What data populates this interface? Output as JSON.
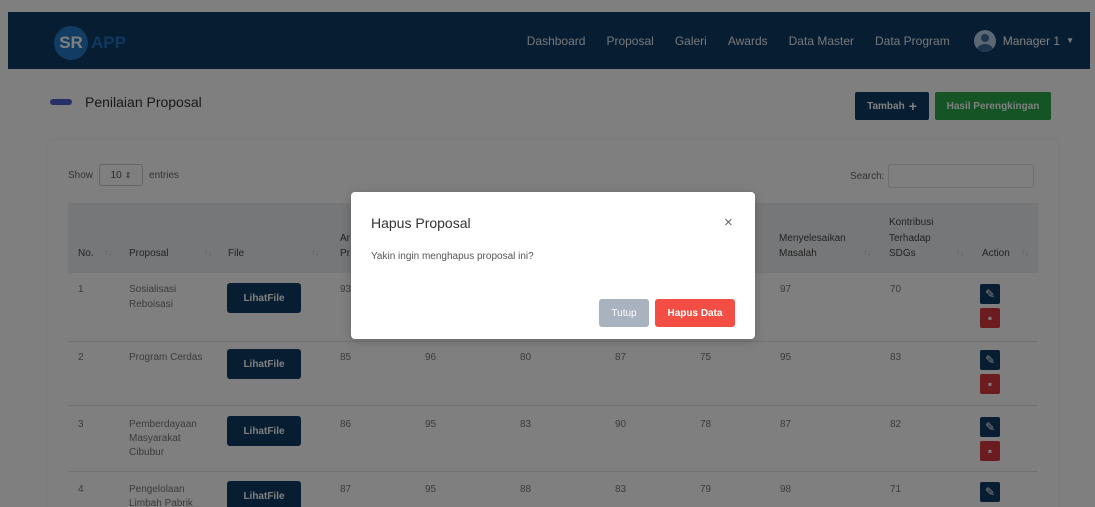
{
  "brand": {
    "logo_short": "SR",
    "logo_app": "APP"
  },
  "nav": {
    "items": [
      {
        "label": "Dashboard"
      },
      {
        "label": "Proposal"
      },
      {
        "label": "Galeri"
      },
      {
        "label": "Awards"
      },
      {
        "label": "Data Master"
      },
      {
        "label": "Data Program"
      }
    ],
    "user": "Manager 1"
  },
  "page": {
    "title": "Penilaian Proposal",
    "btn_tambah": "Tambah",
    "btn_hasil": "Hasil Perengkingan"
  },
  "table_controls": {
    "show_label": "Show",
    "show_value": "10",
    "entries_label": "entries",
    "search_label": "Search:"
  },
  "table": {
    "headers": {
      "no": "No.",
      "proposal": "Proposal",
      "file": "File",
      "ar": "Ar",
      "pr": "Pr",
      "menyelesaikan_1": "Menyelesaikan",
      "menyelesaikan_2": "Masalah",
      "kontribusi_1": "Kontribusi",
      "kontribusi_2": "Terhadap",
      "kontribusi_3": "SDGs",
      "action": "Action"
    },
    "file_label": "LihatFile",
    "rows": [
      {
        "no": "1",
        "proposal_1": "Sosialisasi",
        "proposal_2": "Reboisasi",
        "proposal_3": "",
        "c1": "93",
        "c2": "",
        "c3": "",
        "c4": "",
        "c5": "",
        "c6": "97",
        "c7": "70"
      },
      {
        "no": "2",
        "proposal_1": "Program Cerdas",
        "proposal_2": "",
        "proposal_3": "",
        "c1": "85",
        "c2": "96",
        "c3": "80",
        "c4": "87",
        "c5": "75",
        "c6": "95",
        "c7": "83"
      },
      {
        "no": "3",
        "proposal_1": "Pemberdayaan",
        "proposal_2": "Masyarakat",
        "proposal_3": "Cibubur",
        "c1": "86",
        "c2": "95",
        "c3": "83",
        "c4": "90",
        "c5": "78",
        "c6": "87",
        "c7": "82"
      },
      {
        "no": "4",
        "proposal_1": "Pengelolaan",
        "proposal_2": "Limbah Pabrik",
        "proposal_3": "",
        "c1": "87",
        "c2": "95",
        "c3": "88",
        "c4": "83",
        "c5": "79",
        "c6": "98",
        "c7": "71"
      }
    ]
  },
  "modal": {
    "title": "Hapus Proposal",
    "close": "×",
    "body": "Yakin ingin menghapus proposal ini?",
    "btn_tutup": "Tutup",
    "btn_hapus": "Hapus Data"
  },
  "icons": {
    "edit": "pencil-icon",
    "delete": "trash-icon",
    "plus": "plus-icon"
  },
  "colors": {
    "navbar": "#0f3b63",
    "success": "#2aa84a",
    "danger": "#f24e43",
    "accent": "#4f5fd0"
  }
}
